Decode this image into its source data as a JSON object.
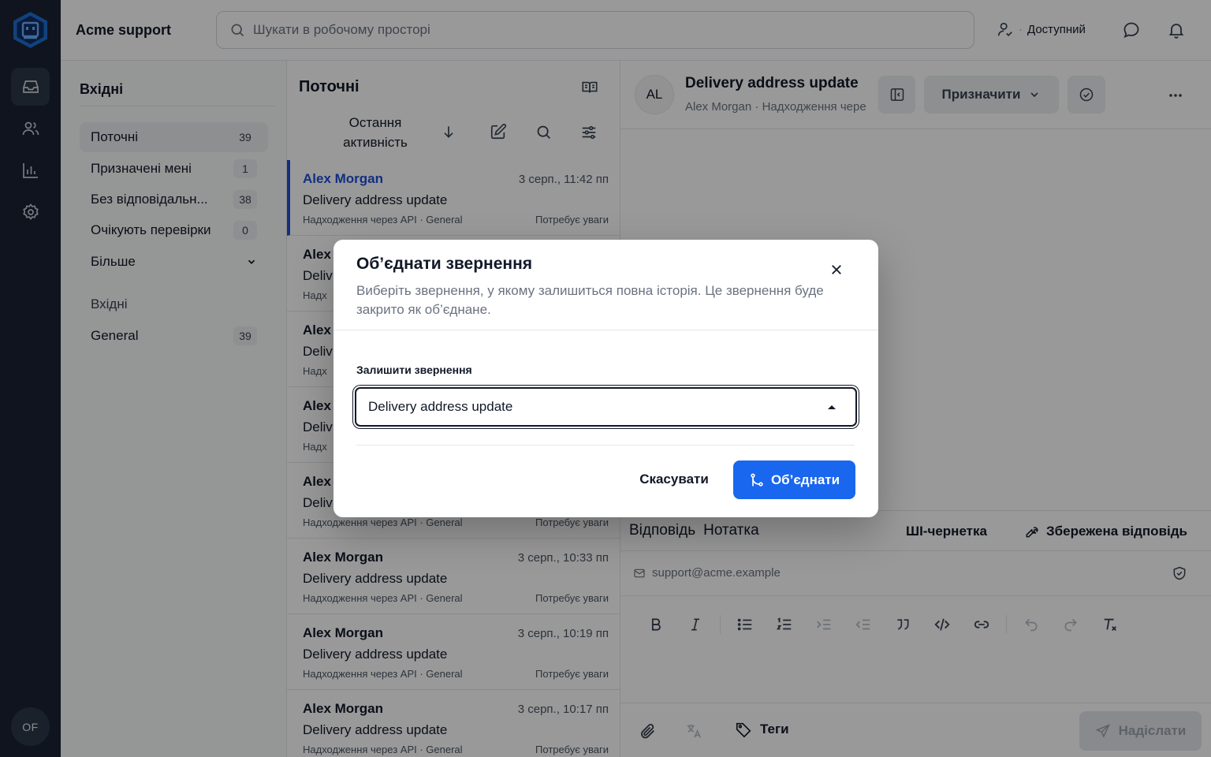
{
  "app": {
    "name": "Acme support",
    "user_initials": "OF"
  },
  "search": {
    "placeholder": "Шукати в робочому просторі"
  },
  "status": {
    "label": "Доступний"
  },
  "inbox_nav": {
    "title": "Вхідні",
    "items": [
      {
        "label": "Поточні",
        "count": "39"
      },
      {
        "label": "Призначені мені",
        "count": "1"
      },
      {
        "label": "Без відповідальн...",
        "count": "38"
      },
      {
        "label": "Очікують перевірки",
        "count": "0"
      }
    ],
    "more_label": "Більше",
    "section_label": "Вхідні",
    "inboxes": [
      {
        "label": "General",
        "count": "39"
      }
    ]
  },
  "conversation_list": {
    "title": "Поточні",
    "sort_label": "Остання активність",
    "items": [
      {
        "name": "Alex Morgan",
        "time": "3 серп., 11:42 пп",
        "subject": "Delivery address update",
        "meta": "Надходження через API · General",
        "tag": "Потребує уваги"
      },
      {
        "name": "Alex",
        "time": "",
        "subject": "Deliv",
        "meta": "Надх",
        "tag": ""
      },
      {
        "name": "Alex",
        "time": "",
        "subject": "Deliv",
        "meta": "Надх",
        "tag": ""
      },
      {
        "name": "Alex",
        "time": "",
        "subject": "Deliv",
        "meta": "Надх",
        "tag": ""
      },
      {
        "name": "Alex",
        "time": "",
        "subject": "Deliv",
        "meta": "Надходження через API · General",
        "tag": "Потребує уваги"
      },
      {
        "name": "Alex Morgan",
        "time": "3 серп., 10:33 пп",
        "subject": "Delivery address update",
        "meta": "Надходження через API · General",
        "tag": "Потребує уваги"
      },
      {
        "name": "Alex Morgan",
        "time": "3 серп., 10:19 пп",
        "subject": "Delivery address update",
        "meta": "Надходження через API · General",
        "tag": "Потребує уваги"
      },
      {
        "name": "Alex Morgan",
        "time": "3 серп., 10:17 пп",
        "subject": "Delivery address update",
        "meta": "Надходження через API · General",
        "tag": "Потребує уваги"
      }
    ]
  },
  "detail": {
    "avatar": "AL",
    "title": "Delivery address update",
    "subtitle_name": "Alex Morgan",
    "subtitle_source": "Надходження чере",
    "assign_label": "Призначити",
    "compose": {
      "tab_reply": "Відповідь",
      "tab_note": "Нотатка",
      "ai_draft": "ШІ-чернетка",
      "saved_reply": "Збережена відповідь",
      "from_email": "support@acme.example",
      "tags_label": "Теги",
      "send_label": "Надіслати"
    }
  },
  "modal": {
    "title": "Об’єднати звернення",
    "description": "Виберіть звернення, у якому залишиться повна історія. Це звернення буде закрито як об’єднане.",
    "field_label": "Залишити звернення",
    "selected_value": "Delivery address update",
    "cancel_label": "Скасувати",
    "merge_label": "Об’єднати"
  },
  "colors": {
    "rail": "#1a2233",
    "accent": "#1967ee",
    "active_link": "#1d4ed8"
  }
}
